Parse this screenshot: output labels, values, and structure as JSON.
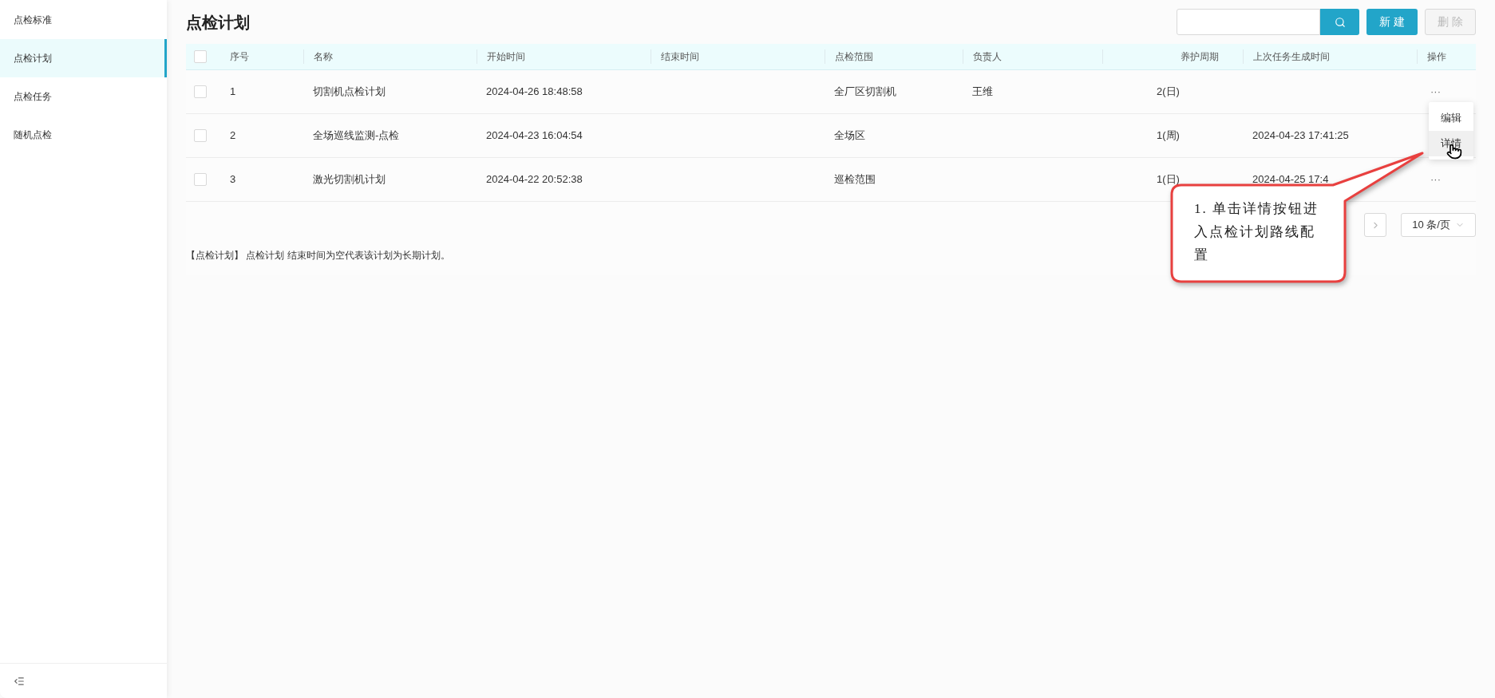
{
  "sidebar": {
    "items": [
      {
        "label": "点检标准",
        "selected": false
      },
      {
        "label": "点检计划",
        "selected": true
      },
      {
        "label": "点检任务",
        "selected": false
      },
      {
        "label": "随机点检",
        "selected": false
      }
    ]
  },
  "page": {
    "title": "点检计划"
  },
  "buttons": [
    {
      "label": "新 建",
      "disabled": false
    },
    {
      "label": "删 除",
      "disabled": true
    }
  ],
  "table": {
    "header_checked": false,
    "columns": [
      "序号",
      "名称",
      "开始时间",
      "结束时间",
      "点检范围",
      "负责人",
      "养护周期",
      "上次任务生成时间",
      "操作"
    ],
    "rows": [
      {
        "checked": false,
        "cells": [
          "1",
          "切割机点检计划",
          "2024-04-26 18:48:58",
          "",
          "全厂区切割机",
          "王维",
          "2(日)",
          ""
        ],
        "actions": "···"
      },
      {
        "checked": false,
        "cells": [
          "2",
          "全场巡线监测-点检",
          "2024-04-23 16:04:54",
          "",
          "全场区",
          "",
          "1(周)",
          "2024-04-23 17:41:25"
        ]
      },
      {
        "checked": false,
        "cells": [
          "3",
          "激光切割机计划",
          "2024-04-22 20:52:38",
          "",
          "巡检范围",
          "",
          "1(日)",
          "2024-04-25 17:4"
        ],
        "actions": "···"
      }
    ]
  },
  "action_menu": {
    "items": [
      {
        "label": "编辑",
        "highlighted": false
      },
      {
        "label": "详情",
        "highlighted": true
      }
    ]
  },
  "pagination": {
    "page_size": "10 条/页"
  },
  "note": "【点检计划】 点检计划 结束时间为空代表该计划为长期计划。",
  "callout": {
    "text": "1. 单击详情按钮进入点检计划路线配置"
  }
}
